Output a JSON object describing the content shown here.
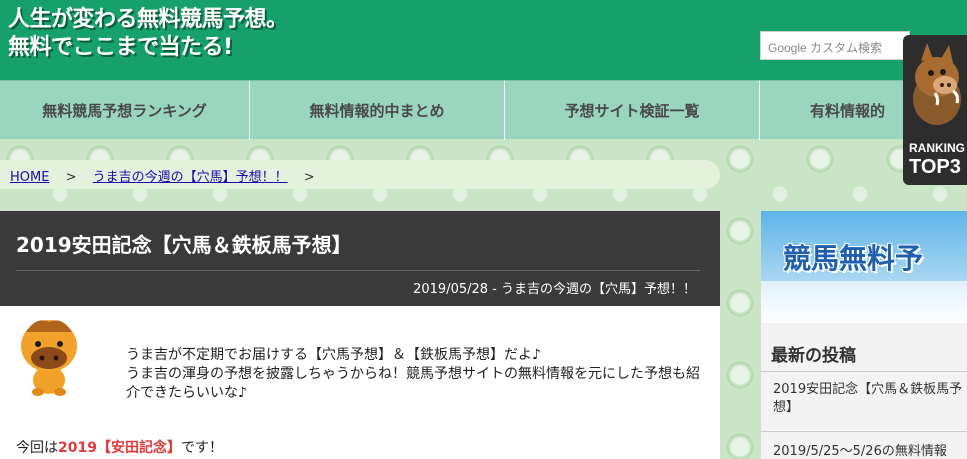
{
  "header": {
    "title_line1": "人生が変わる無料競馬予想。",
    "title_line2": "無料でここまで当たる!",
    "search_placeholder": "Google カスタム検索"
  },
  "nav": {
    "items": [
      {
        "label": "無料競馬予想ランキング"
      },
      {
        "label": "無料情報的中まとめ"
      },
      {
        "label": "予想サイト検証一覧"
      },
      {
        "label": "有料情報的"
      }
    ]
  },
  "ranking_badge": {
    "line1": "RANKING",
    "line2": "TOP3"
  },
  "breadcrumb": {
    "home": "HOME",
    "sep": ">",
    "category": "うま吉の今週の【穴馬】予想！！"
  },
  "article": {
    "title": "2019安田記念【穴馬＆鉄板馬予想】",
    "meta": "2019/05/28 - うま吉の今週の【穴馬】予想！！",
    "intro_line1": "うま吉が不定期でお届けする【穴馬予想】＆【鉄板馬予想】だよ♪",
    "intro_line2": "うま吉の渾身の予想を披露しちゃうからね！競馬予想サイトの無料情報を元にした予想も紹介できたらいいな♪",
    "lead_prefix": "今回は",
    "lead_highlight": "2019【安田記念】",
    "lead_suffix": "です！"
  },
  "sidebar": {
    "banner_text": "競馬無料予",
    "heading": "最新の投稿",
    "posts": [
      {
        "title": "2019安田記念【穴馬＆鉄板馬予想】"
      },
      {
        "title": "2019/5/25～5/26の無料情報"
      }
    ]
  },
  "colors": {
    "header_green": "#16a06a",
    "nav_mint": "#9ad6bf",
    "article_dark": "#3a3a3a",
    "highlight_red": "#e23a3a"
  }
}
